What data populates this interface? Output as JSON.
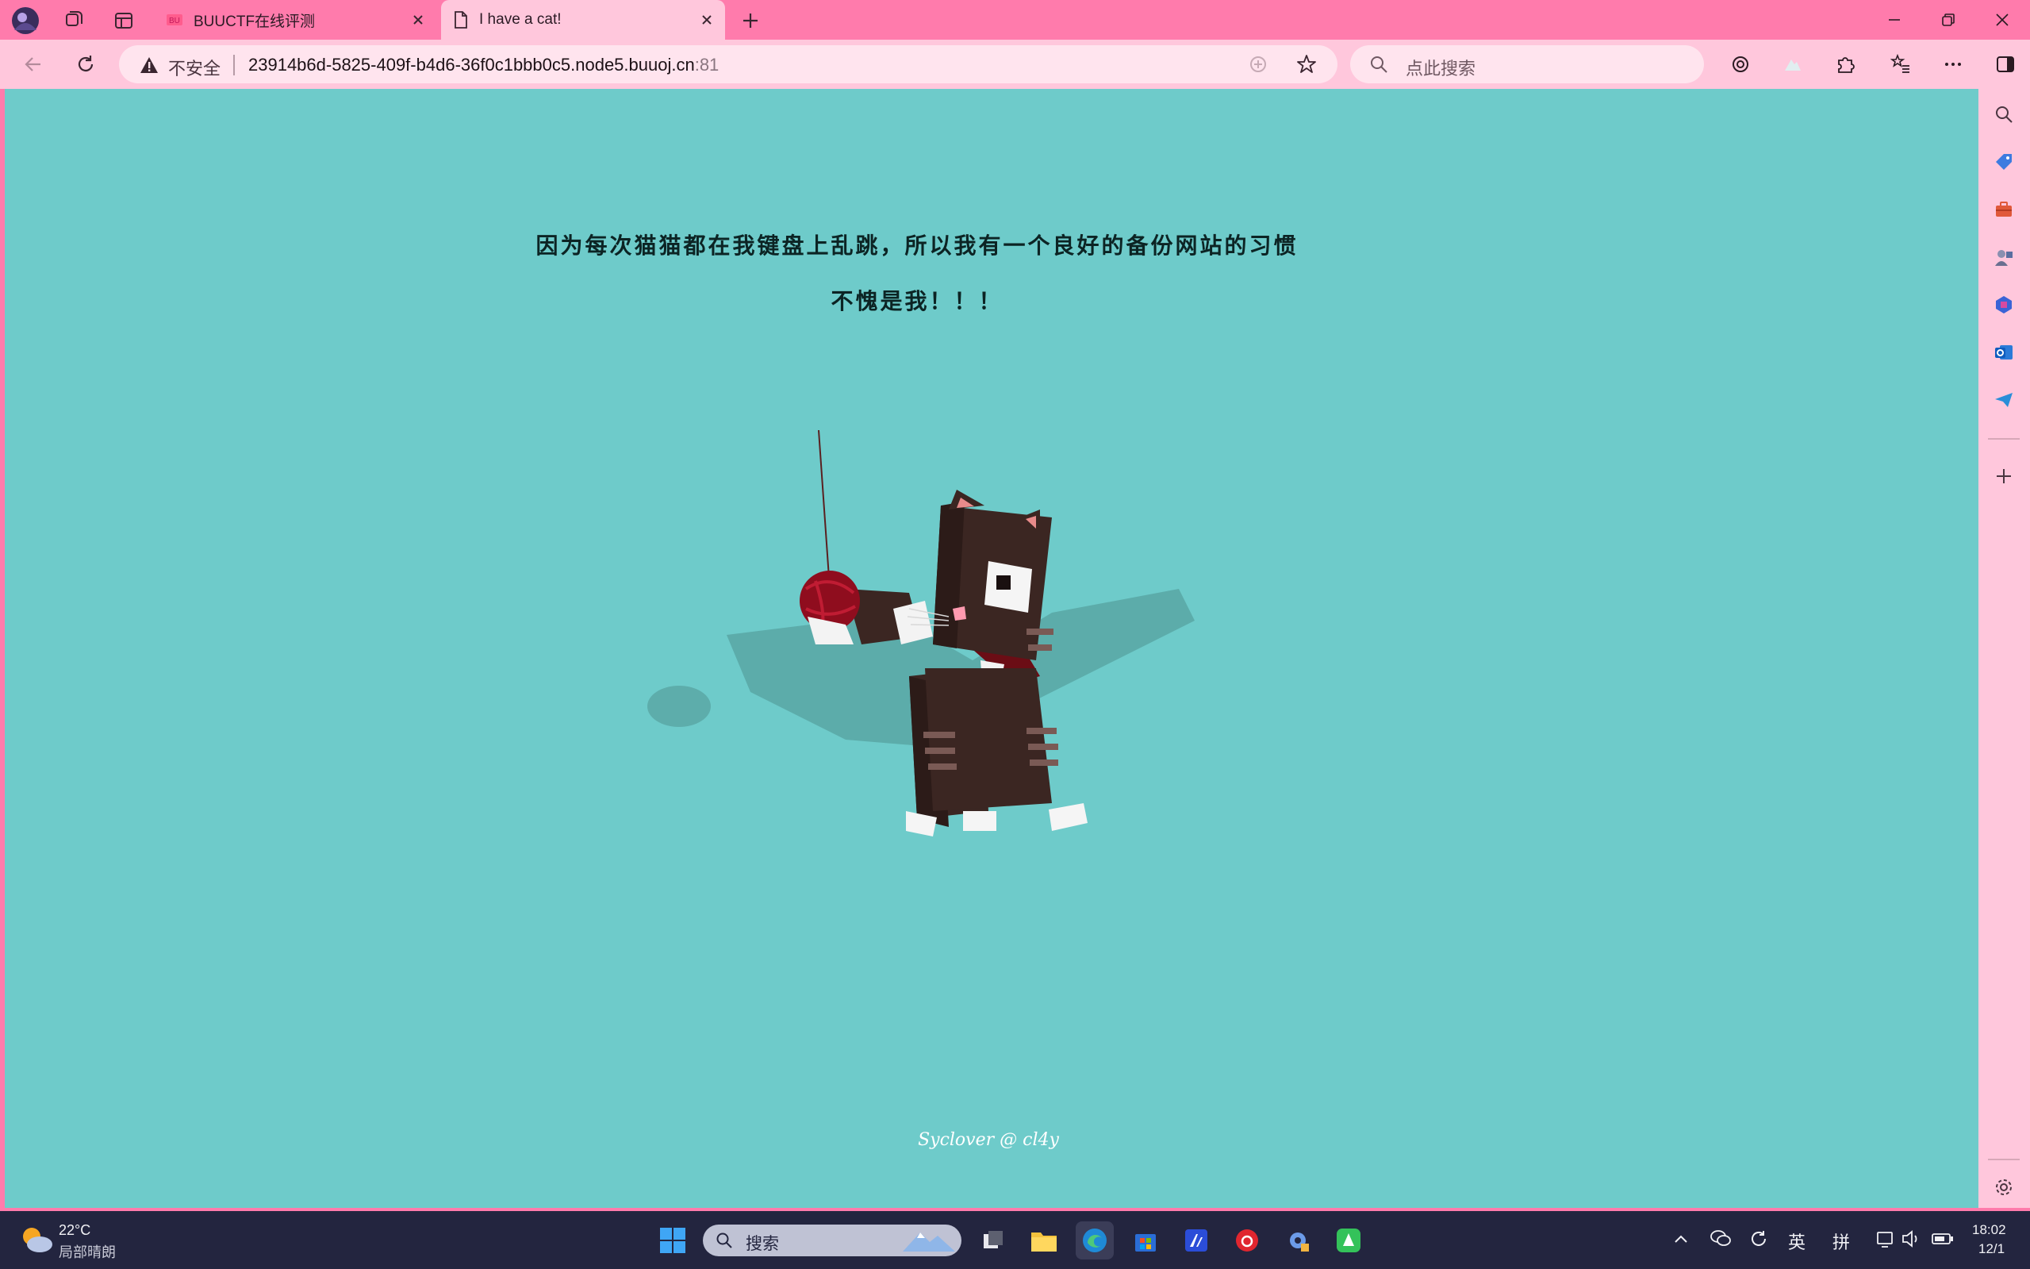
{
  "tabs": [
    {
      "title": "BUUCTF在线评测",
      "favicon": "buuctf-icon",
      "active": false
    },
    {
      "title": "I have a cat!",
      "favicon": "page-icon",
      "active": true
    }
  ],
  "address": {
    "security_label": "不安全",
    "url_main": "23914b6d-5825-409f-b4d6-36f0c1bbb0c5.node5.buuoj.cn",
    "url_port": ":81"
  },
  "search": {
    "placeholder": "点此搜索"
  },
  "page": {
    "line1": "因为每次猫猫都在我键盘上乱跳，所以我有一个良好的备份网站的习惯",
    "line2": "不愧是我！！！",
    "credit": "Syclover @ cl4y",
    "background": "#6ecbca"
  },
  "taskbar": {
    "weather_temp": "22°C",
    "weather_desc": "局部晴朗",
    "search_placeholder": "搜索",
    "ime_lang": "英",
    "ime_mode": "拼",
    "clock_time": "18:02",
    "clock_date": "12/1"
  },
  "colors": {
    "frame": "#ff7bac",
    "toolbar": "#ffc7dc",
    "taskbar": "#23253f"
  }
}
